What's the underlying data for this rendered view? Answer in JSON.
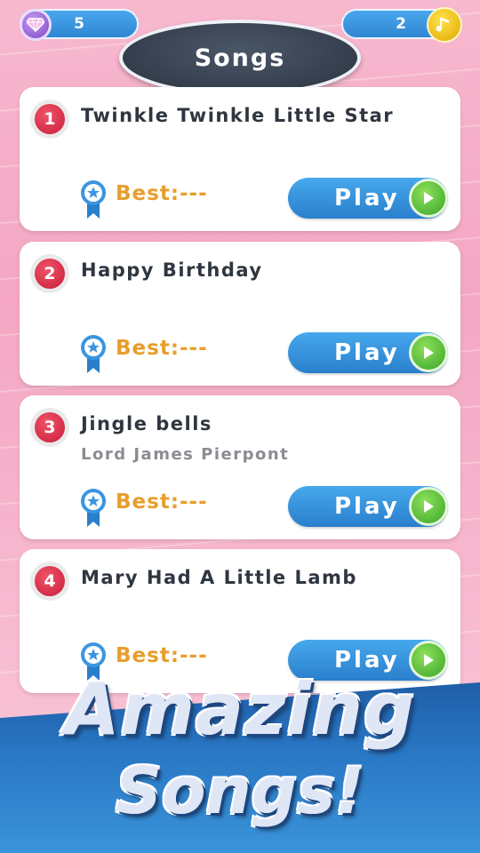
{
  "header": {
    "gems_count": "5",
    "notes_count": "2",
    "title": "Songs"
  },
  "songs": [
    {
      "number": "1",
      "title": "Twinkle Twinkle Little Star",
      "subtitle": "",
      "best_label": "Best:---",
      "play_label": "Play"
    },
    {
      "number": "2",
      "title": "Happy Birthday",
      "subtitle": "",
      "best_label": "Best:---",
      "play_label": "Play"
    },
    {
      "number": "3",
      "title": "Jingle bells",
      "subtitle": "Lord James Pierpont",
      "best_label": "Best:---",
      "play_label": "Play"
    },
    {
      "number": "4",
      "title": "Mary Had A Little Lamb",
      "subtitle": "",
      "best_label": "Best:---",
      "play_label": "Play"
    }
  ],
  "promo": {
    "line1": "Amazing",
    "line2": "Songs!"
  },
  "colors": {
    "accent_blue": "#2f86d3",
    "number_red": "#c81c3a",
    "best_orange": "#e89e2c",
    "play_green": "#3aa52a",
    "background_pink": "#f4a6c3"
  },
  "icons": {
    "gems": "gem-icon",
    "notes": "music-note-icon",
    "medal": "medal-icon",
    "play": "play-triangle-icon"
  }
}
